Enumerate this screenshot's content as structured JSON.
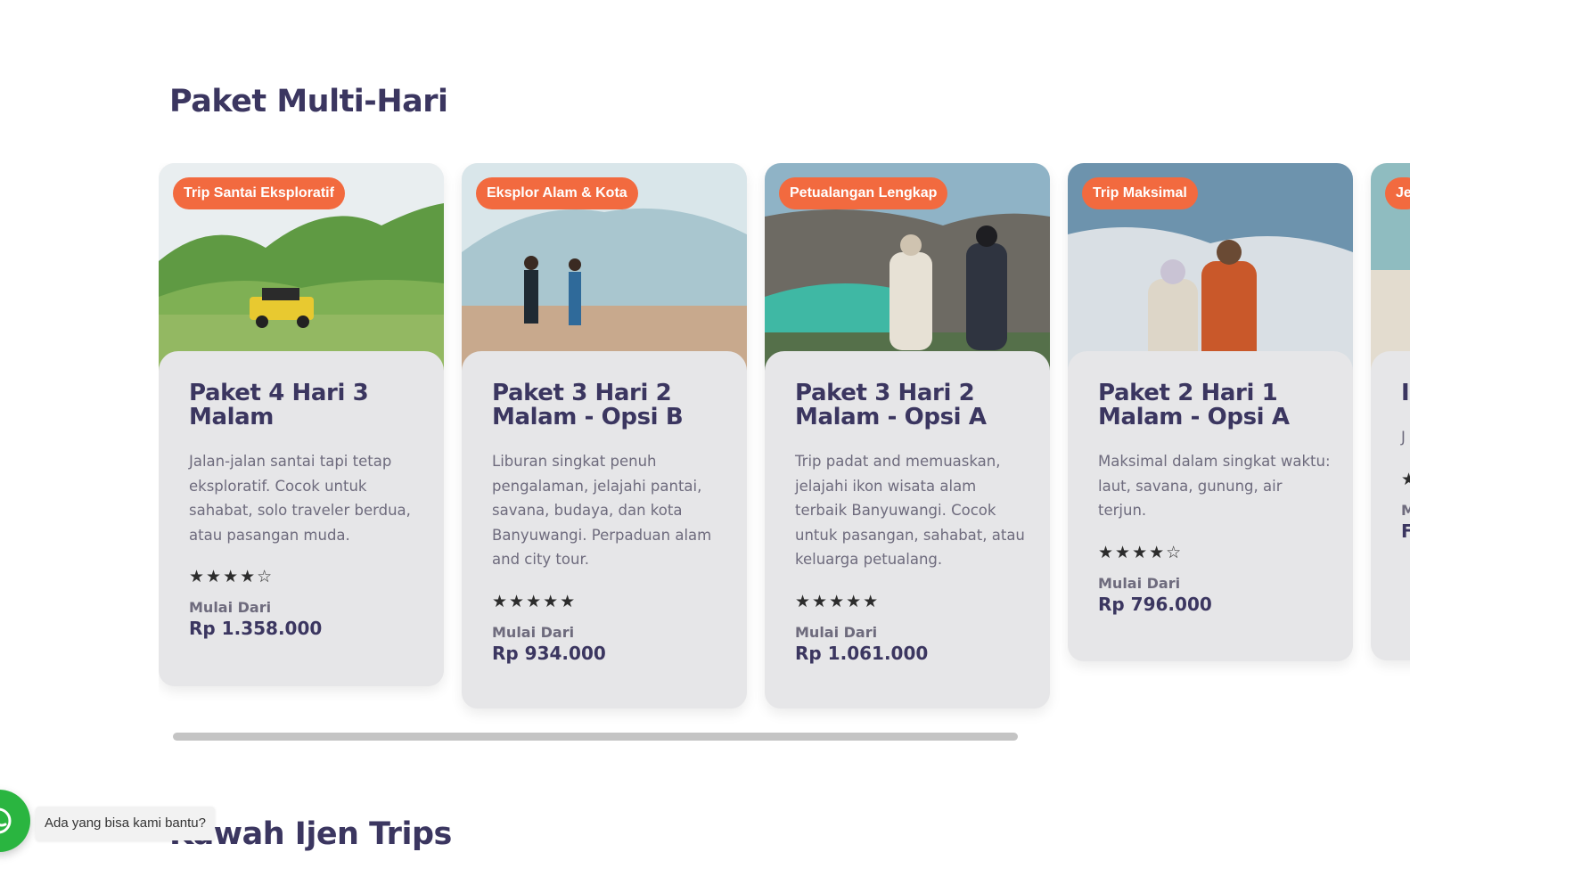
{
  "section": {
    "title": "Paket Multi-Hari"
  },
  "next_section": {
    "title": "Kawah Ijen Trips"
  },
  "chat_widget": {
    "tooltip": "Ada yang bisa kami bantu?",
    "icon": "whatsapp-icon",
    "color": "#2ab540"
  },
  "colors": {
    "badge": "#f26a3f",
    "heading": "#3b3660",
    "card_bg": "#e6e6e8"
  },
  "cards": [
    {
      "badge": "Trip Santai Eksploratif",
      "title": "Paket 4 Hari 3 Malam",
      "description": "Jalan-jalan santai tapi tetap eksploratif. Cocok untuk sahabat, solo traveler berdua, atau pasangan muda.",
      "rating": 4,
      "stars": "★★★★☆",
      "from_label": "Mulai Dari",
      "price": "Rp 1.358.000"
    },
    {
      "badge": "Eksplor Alam & Kota",
      "title": "Paket 3 Hari 2 Malam - Opsi B",
      "description": "Liburan singkat penuh pengalaman, jelajahi pantai, savana, budaya, dan kota Banyuwangi. Perpaduan alam and city tour.",
      "rating": 5,
      "stars": "★★★★★",
      "from_label": "Mulai Dari",
      "price": "Rp 934.000"
    },
    {
      "badge": "Petualangan Lengkap",
      "title": "Paket 3 Hari 2 Malam - Opsi A",
      "description": "Trip padat and memuaskan, jelajahi ikon wisata alam terbaik Banyuwangi. Cocok untuk pasangan, sahabat, atau keluarga petualang.",
      "rating": 5,
      "stars": "★★★★★",
      "from_label": "Mulai Dari",
      "price": "Rp 1.061.000"
    },
    {
      "badge": "Trip Maksimal",
      "title": "Paket 2 Hari 1 Malam - Opsi A",
      "description": "Maksimal dalam singkat waktu: laut, savana, gunung, air terjun.",
      "rating": 4,
      "stars": "★★★★☆",
      "from_label": "Mulai Dari",
      "price": "Rp 796.000"
    },
    {
      "badge": "Je",
      "title": "I I",
      "description": "J h s",
      "rating": 1,
      "stars": "★",
      "from_label": "M",
      "price": "F"
    }
  ]
}
